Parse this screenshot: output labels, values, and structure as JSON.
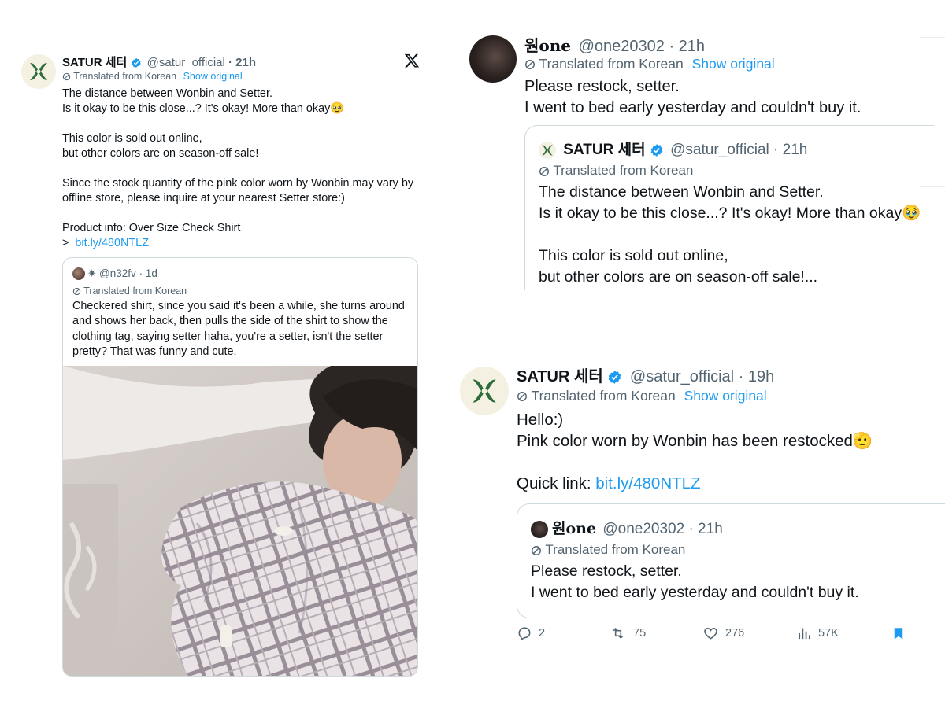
{
  "colors": {
    "link": "#1d9bf0",
    "verified": "#1d9bf0",
    "muted": "#536471",
    "text": "#0f1419",
    "logo_green": "#2e6b3a"
  },
  "left_tweet": {
    "name": "SATUR 세터",
    "handle": "@satur_official",
    "time": "· 21h",
    "translated_label": "Translated from Korean",
    "show_original": "Show original",
    "body": {
      "p1": "The distance between Wonbin and Setter.\nIs it okay to be this close...? It's okay! More than okay🥹",
      "p2": "This color is sold out online,\nbut other colors are on season-off sale!",
      "p3": "Since the stock quantity of the pink color worn by Wonbin may vary by offline store, please inquire at your nearest Setter store:)",
      "p4_label": "Product info: Over Size Check Shirt",
      "p4_prefix": ">",
      "link": "bit.ly/480NTLZ"
    },
    "quote": {
      "handle": "✷ @n32fv",
      "time": "· 1d",
      "translated_label": "Translated from Korean",
      "body": "Checkered shirt, since you said it's been a while, she turns around and shows her back, then pulls the side of the shirt to show the clothing tag, saying setter haha, you're a setter, isn't the setter pretty? That was funny and cute."
    }
  },
  "top_right_tweet": {
    "name": "원one",
    "handle": "@one20302",
    "time": "· 21h",
    "translated_label": "Translated from Korean",
    "show_original": "Show original",
    "body": "Please restock, setter.\nI went to bed early yesterday and couldn't buy it.",
    "quote": {
      "name": "SATUR 세터",
      "handle": "@satur_official",
      "time": "· 21h",
      "translated_label": "Translated from Korean",
      "body": "The distance between Wonbin and Setter.\nIs it okay to be this close...? It's okay! More than okay🥹\n\nThis color is sold out online,\nbut other colors are on season-off sale!..."
    }
  },
  "bottom_right_tweet": {
    "name": "SATUR 세터",
    "handle": "@satur_official",
    "time": "· 19h",
    "translated_label": "Translated from Korean",
    "show_original": "Show original",
    "line1": "Hello:)",
    "line2": "Pink color worn by Wonbin has been restocked🫡",
    "quick_link_label": "Quick link:",
    "link": "bit.ly/480NTLZ",
    "quote": {
      "name": "원one",
      "handle": "@one20302",
      "time": "· 21h",
      "translated_label": "Translated from Korean",
      "body": "Please restock, setter.\nI went to bed early yesterday and couldn't buy it."
    },
    "actions": {
      "replies": "2",
      "reposts": "75",
      "likes": "276",
      "views": "57K"
    }
  }
}
